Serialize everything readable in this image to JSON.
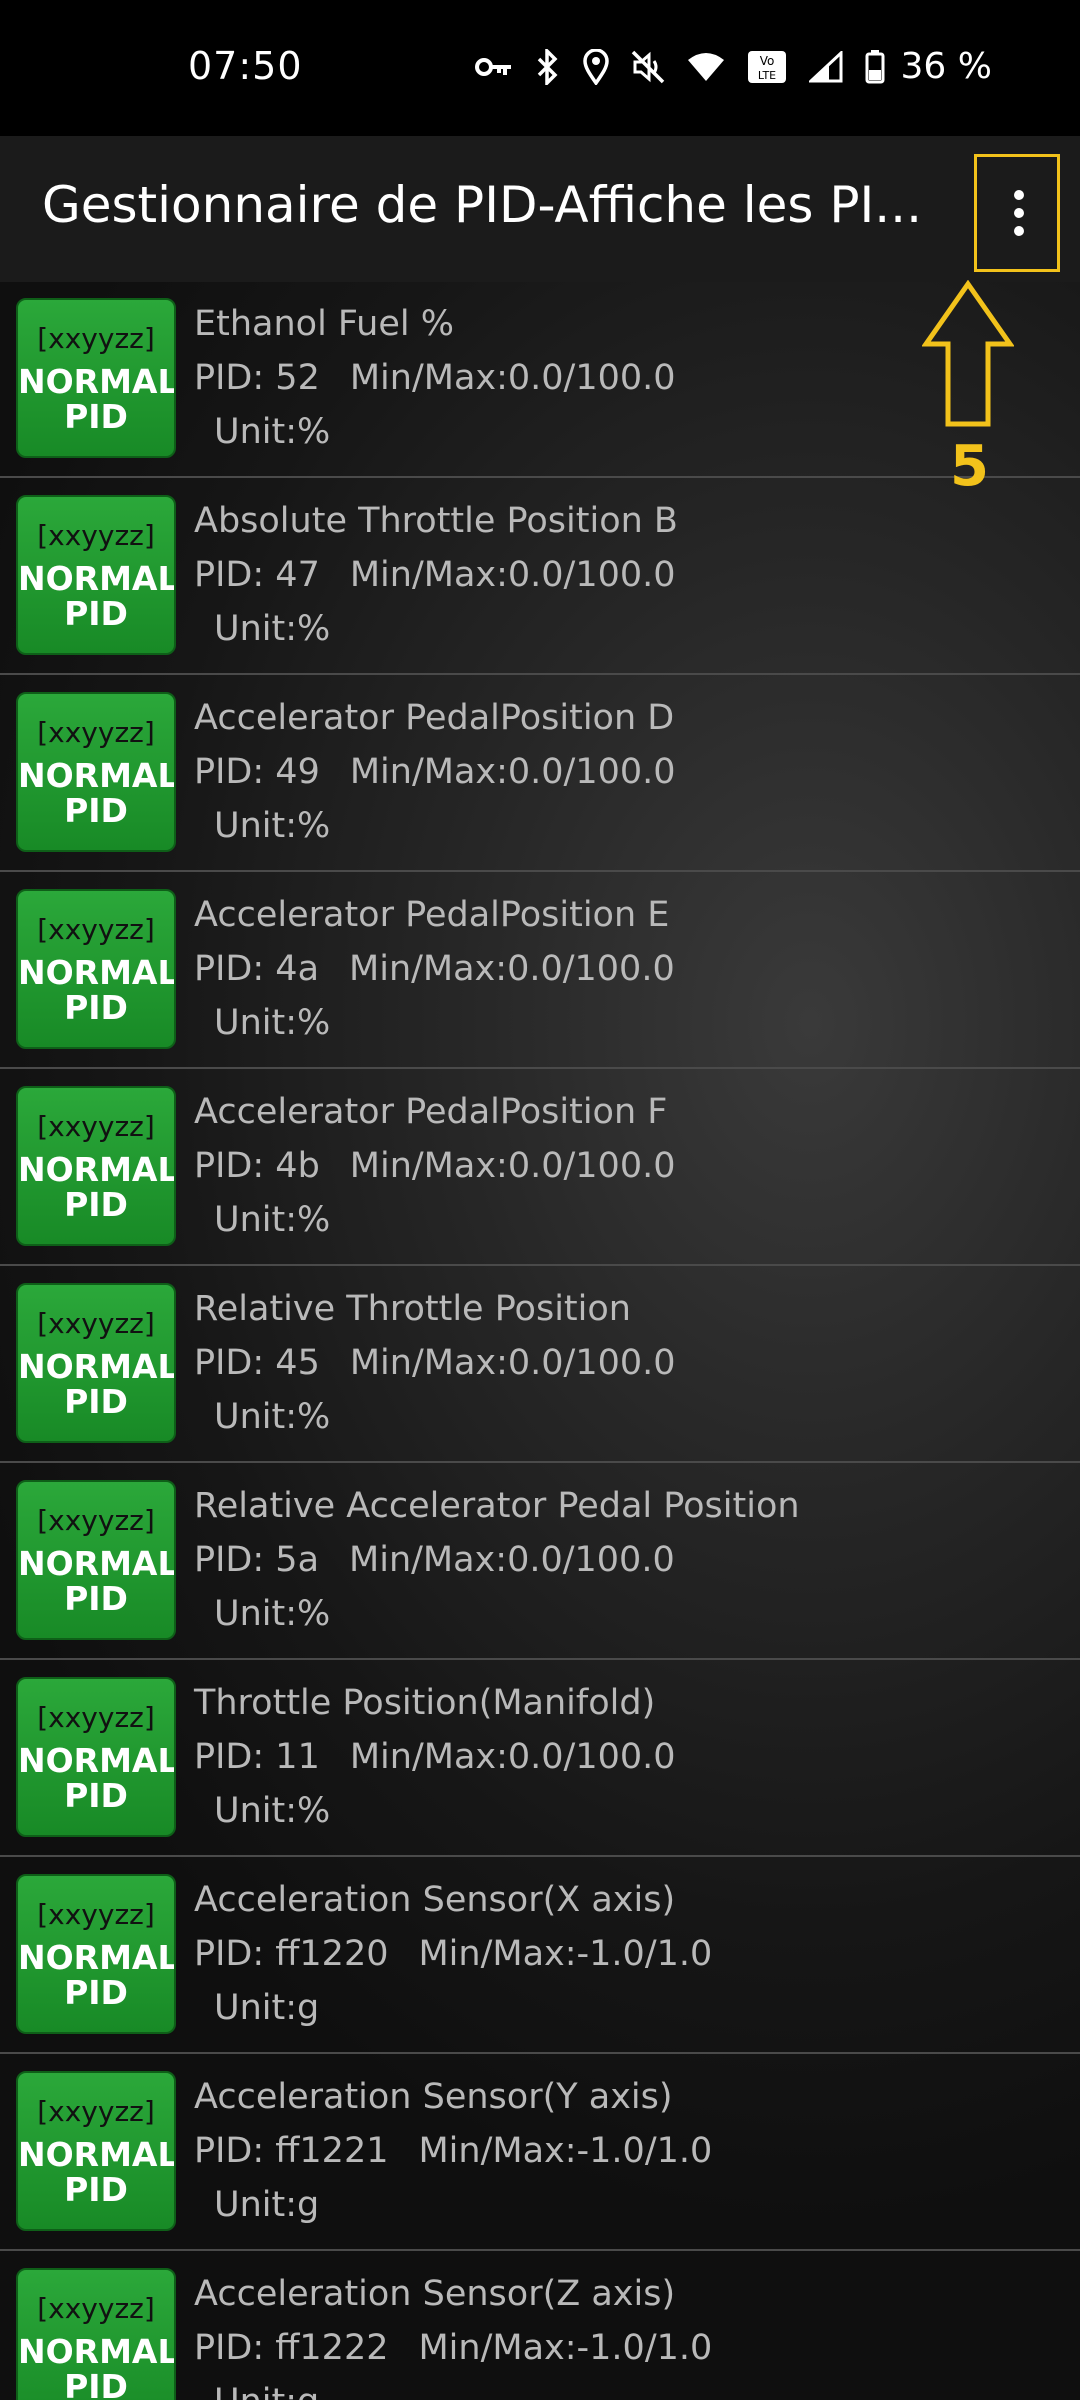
{
  "status_bar": {
    "time": "07:50",
    "battery": "36 %"
  },
  "app_bar": {
    "title": "Gestionnaire de PID-Affiche les PI..."
  },
  "annotation": {
    "number": "5",
    "color": "#f2c21b"
  },
  "badge": {
    "code": "[xxyyzz]",
    "line1": "NORMAL",
    "line2": "PID"
  },
  "pids": [
    {
      "name": "Ethanol Fuel %",
      "pid": "PID: 52",
      "minmax": "Min/Max:0.0/100.0",
      "unit": "Unit:%"
    },
    {
      "name": "Absolute Throttle Position B",
      "pid": "PID: 47",
      "minmax": "Min/Max:0.0/100.0",
      "unit": "Unit:%"
    },
    {
      "name": "Accelerator PedalPosition D",
      "pid": "PID: 49",
      "minmax": "Min/Max:0.0/100.0",
      "unit": "Unit:%"
    },
    {
      "name": "Accelerator PedalPosition E",
      "pid": "PID: 4a",
      "minmax": "Min/Max:0.0/100.0",
      "unit": "Unit:%"
    },
    {
      "name": "Accelerator PedalPosition F",
      "pid": "PID: 4b",
      "minmax": "Min/Max:0.0/100.0",
      "unit": "Unit:%"
    },
    {
      "name": "Relative Throttle Position",
      "pid": "PID: 45",
      "minmax": "Min/Max:0.0/100.0",
      "unit": "Unit:%"
    },
    {
      "name": "Relative Accelerator Pedal Position",
      "pid": "PID: 5a",
      "minmax": "Min/Max:0.0/100.0",
      "unit": "Unit:%"
    },
    {
      "name": "Throttle Position(Manifold)",
      "pid": "PID: 11",
      "minmax": "Min/Max:0.0/100.0",
      "unit": "Unit:%"
    },
    {
      "name": "Acceleration Sensor(X axis)",
      "pid": "PID: ff1220",
      "minmax": "Min/Max:-1.0/1.0",
      "unit": "Unit:g"
    },
    {
      "name": "Acceleration Sensor(Y axis)",
      "pid": "PID: ff1221",
      "minmax": "Min/Max:-1.0/1.0",
      "unit": "Unit:g"
    },
    {
      "name": "Acceleration Sensor(Z axis)",
      "pid": "PID: ff1222",
      "minmax": "Min/Max:-1.0/1.0",
      "unit": "Unit:g"
    }
  ]
}
